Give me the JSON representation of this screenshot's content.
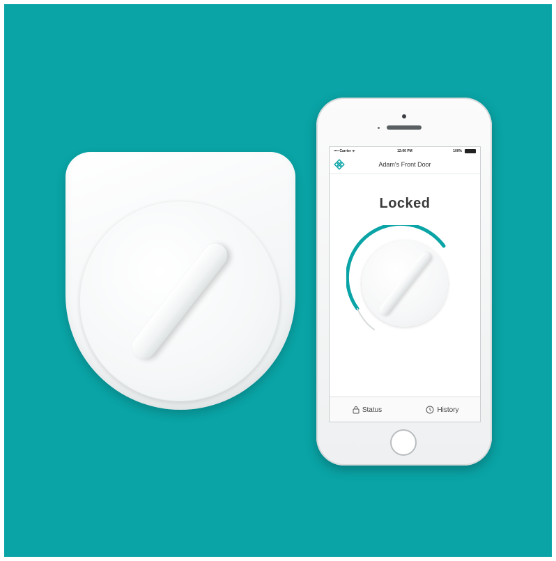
{
  "app": {
    "status_bar": {
      "carrier": "•••• Carrier ᯤ",
      "time": "12:00 PM",
      "battery": "100%"
    },
    "nav_title": "Adam's Front Door",
    "lock_state": "Locked",
    "tabs": [
      {
        "label": "Status",
        "icon": "lock-icon"
      },
      {
        "label": "History",
        "icon": "clock-icon"
      }
    ]
  },
  "colors": {
    "background": "#0aa4a6",
    "accent": "#0aa4a6"
  }
}
